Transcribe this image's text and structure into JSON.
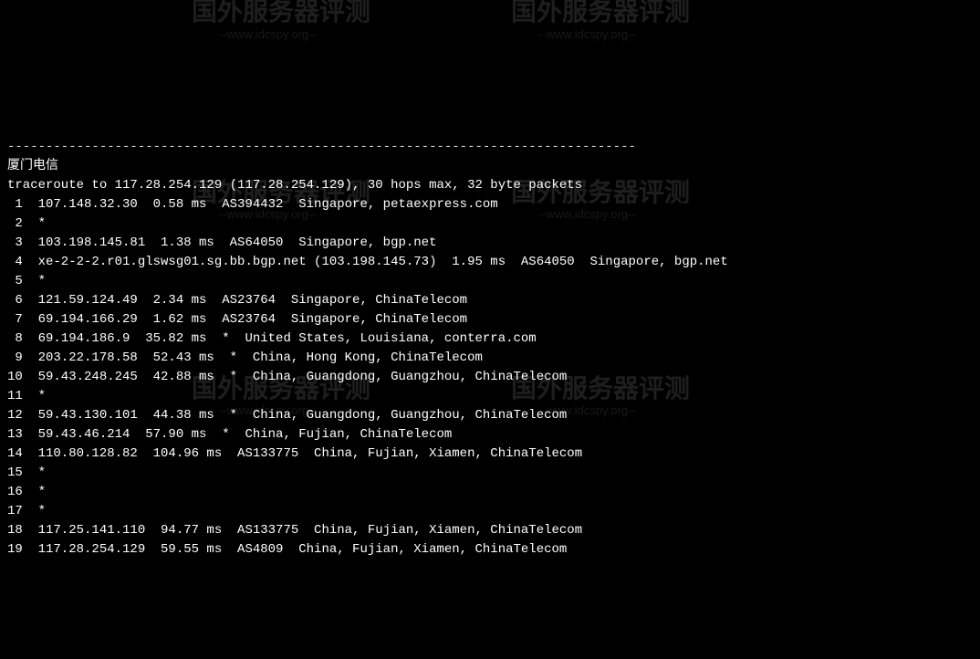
{
  "terminal": {
    "dashLine": "----------------------------------------------------------------------------------",
    "headerTitle": "厦门电信",
    "traceHeader": "traceroute to 117.28.254.129 (117.28.254.129), 30 hops max, 32 byte packets",
    "hops": [
      " 1  107.148.32.30  0.58 ms  AS394432  Singapore, petaexpress.com",
      " 2  *",
      " 3  103.198.145.81  1.38 ms  AS64050  Singapore, bgp.net",
      " 4  xe-2-2-2.r01.glswsg01.sg.bb.bgp.net (103.198.145.73)  1.95 ms  AS64050  Singapore, bgp.net",
      " 5  *",
      " 6  121.59.124.49  2.34 ms  AS23764  Singapore, ChinaTelecom",
      " 7  69.194.166.29  1.62 ms  AS23764  Singapore, ChinaTelecom",
      " 8  69.194.186.9  35.82 ms  *  United States, Louisiana, conterra.com",
      " 9  203.22.178.58  52.43 ms  *  China, Hong Kong, ChinaTelecom",
      "10  59.43.248.245  42.88 ms  *  China, Guangdong, Guangzhou, ChinaTelecom",
      "11  *",
      "12  59.43.130.101  44.38 ms  *  China, Guangdong, Guangzhou, ChinaTelecom",
      "13  59.43.46.214  57.90 ms  *  China, Fujian, ChinaTelecom",
      "14  110.80.128.82  104.96 ms  AS133775  China, Fujian, Xiamen, ChinaTelecom",
      "15  *",
      "16  *",
      "17  *",
      "18  117.25.141.110  94.77 ms  AS133775  China, Fujian, Xiamen, ChinaTelecom",
      "19  117.28.254.129  59.55 ms  AS4809  China, Fujian, Xiamen, ChinaTelecom"
    ]
  },
  "watermark": {
    "text": "国外服务器评测",
    "url": "--www.idcspy.org--"
  }
}
